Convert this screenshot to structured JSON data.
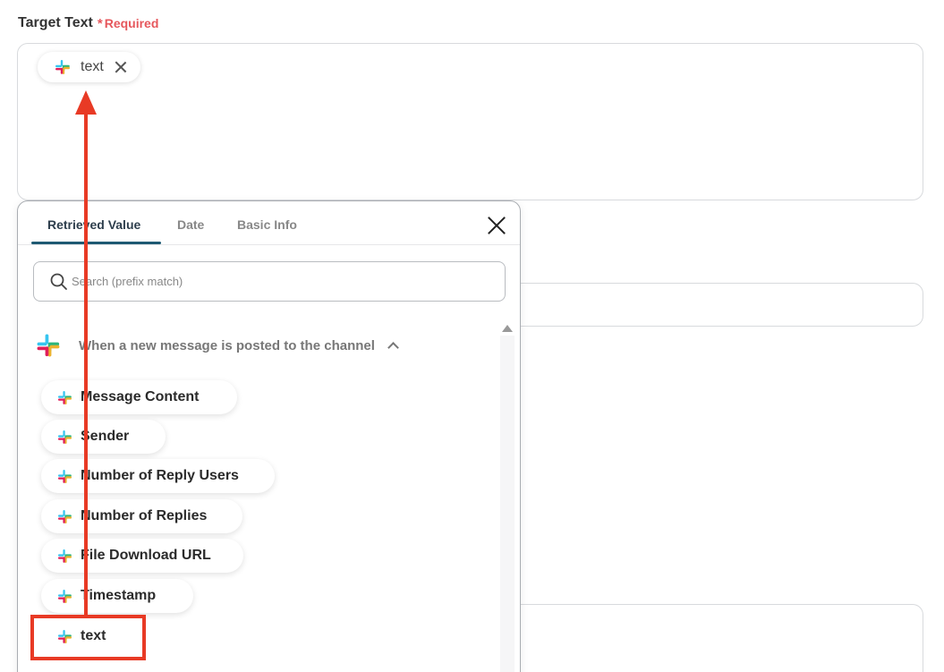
{
  "field": {
    "label": "Target Text",
    "required_star": "*",
    "required_text": "Required"
  },
  "token": {
    "label": "text"
  },
  "popup": {
    "tabs": [
      {
        "label": "Retrieved Value",
        "active": true
      },
      {
        "label": "Date",
        "active": false
      },
      {
        "label": "Basic Info",
        "active": false
      }
    ],
    "search_placeholder": "Search (prefix match)",
    "section_title": "When a new message is posted to the channel",
    "items": [
      "Message Content",
      "Sender",
      "Number of Reply Users",
      "Number of Replies",
      "File Download URL",
      "Timestamp",
      "text"
    ]
  },
  "colors": {
    "accent": "#1e5a73",
    "required": "#e6575c",
    "annotation": "#e83a25"
  },
  "icons": {
    "app": "slack-icon",
    "search": "search-icon",
    "close": "close-icon",
    "collapse": "chevron-up-icon"
  }
}
